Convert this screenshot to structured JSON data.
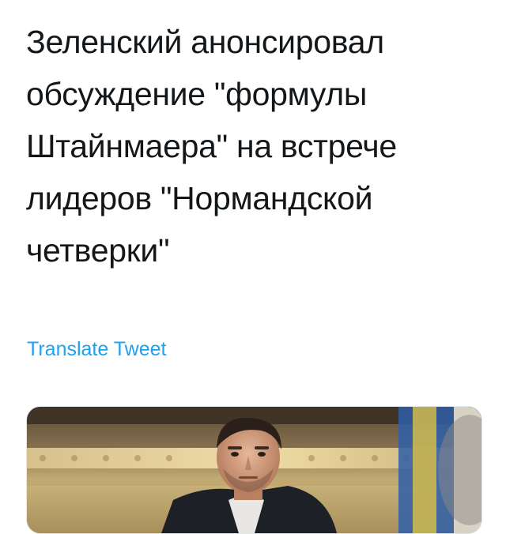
{
  "tweet": {
    "text": "Зеленский анонсировал обсуждение \"формулы Штайнмаера\" на встрече лидеров \"Нормандской четверки\"",
    "translate_label": "Translate Tweet"
  },
  "media": {
    "description": "photo-thumbnail"
  },
  "colors": {
    "text": "#14171a",
    "link": "#1da1f2"
  }
}
